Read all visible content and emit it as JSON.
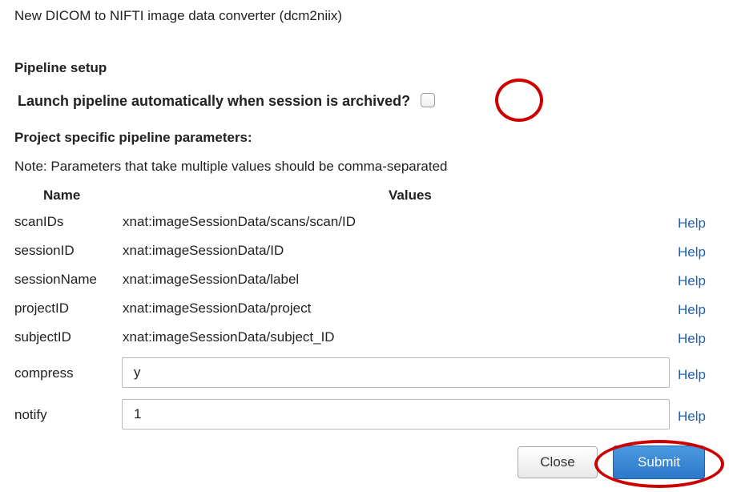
{
  "dialog": {
    "title": "New DICOM to NIFTI image data converter (dcm2niix)"
  },
  "pipeline_setup": {
    "section_title": "Pipeline setup",
    "auto_launch_label": "Launch pipeline automatically when session is archived?",
    "auto_launch_checked": false
  },
  "parameters": {
    "section_title": "Project specific pipeline parameters:",
    "note": "Note: Parameters that take multiple values should be comma-separated",
    "name_header": "Name",
    "values_header": "Values",
    "help_label": "Help",
    "rows": [
      {
        "name": "scanIDs",
        "value": "xnat:imageSessionData/scans/scan/ID"
      },
      {
        "name": "sessionID",
        "value": "xnat:imageSessionData/ID"
      },
      {
        "name": "sessionName",
        "value": "xnat:imageSessionData/label"
      },
      {
        "name": "projectID",
        "value": "xnat:imageSessionData/project"
      },
      {
        "name": "subjectID",
        "value": "xnat:imageSessionData/subject_ID"
      }
    ],
    "inputs": [
      {
        "name": "compress",
        "value": "y"
      },
      {
        "name": "notify",
        "value": "1"
      }
    ]
  },
  "footer": {
    "close_label": "Close",
    "submit_label": "Submit"
  },
  "colors": {
    "highlight_ring": "#cc0000",
    "submit_bg": "#2d78c8",
    "help_link": "#1f5fb8"
  }
}
